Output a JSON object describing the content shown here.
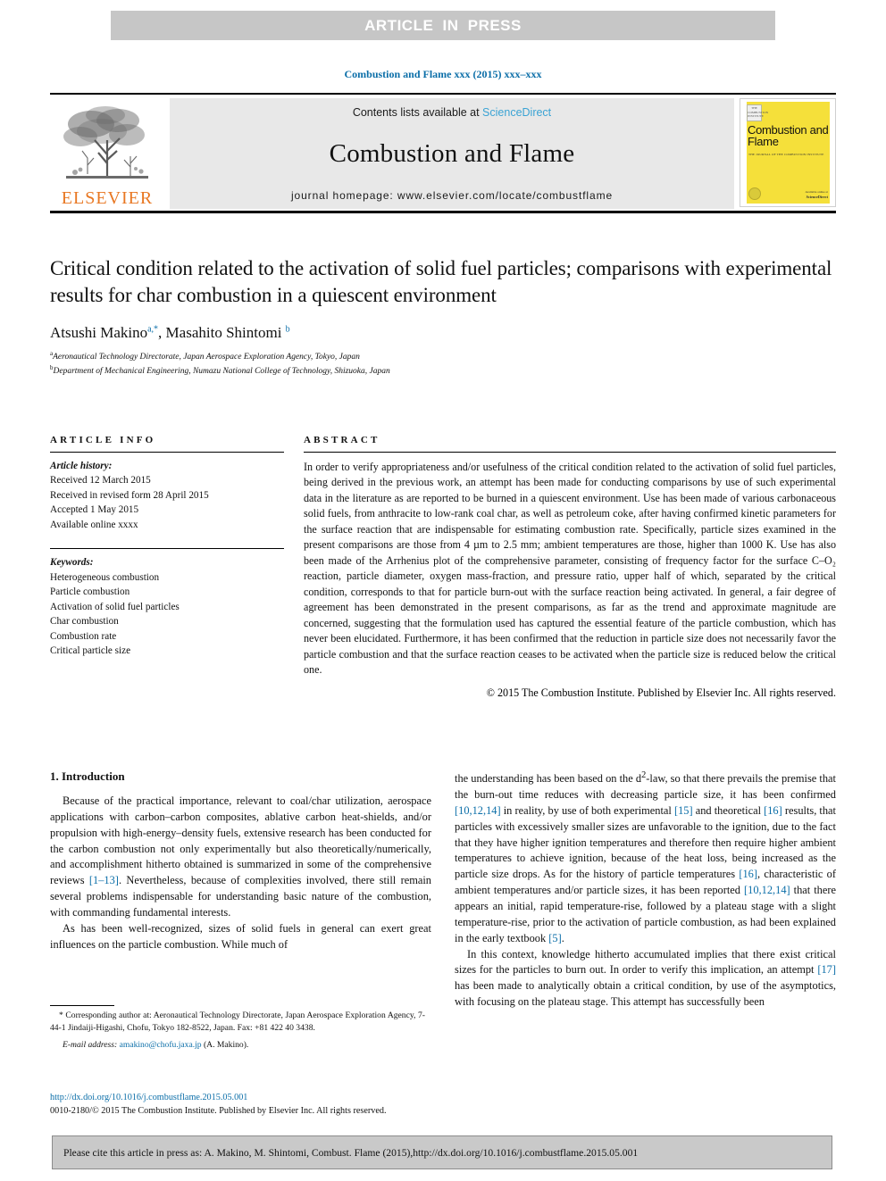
{
  "banner": {
    "text": "ARTICLE  IN  PRESS"
  },
  "journal_ref": "Combustion and Flame xxx (2015) xxx–xxx",
  "masthead": {
    "contents_prefix": "Contents lists available at ",
    "sciencedirect": "ScienceDirect",
    "journal_title": "Combustion and Flame",
    "homepage": "journal homepage: www.elsevier.com/locate/combustflame",
    "publisher_word": "ELSEVIER",
    "cover": {
      "badge": "THE COMBUSTION INSTITUTE",
      "title": "Combustion and Flame",
      "subtitle": "THE JOURNAL OF THE COMBUSTION INSTITUTE",
      "foot_small": "Available online at",
      "foot_bold": "ScienceDirect"
    }
  },
  "article": {
    "title": "Critical condition related to the activation of solid fuel particles; comparisons with experimental results for char combustion in a quiescent environment",
    "authors_1": "Atsushi Makino",
    "authors_sup_1": "a,*",
    "authors_2": ", Masahito Shintomi ",
    "authors_sup_2": "b",
    "affiliation_a_sup": "a",
    "affiliation_a": "Aeronautical Technology Directorate, Japan Aerospace Exploration Agency, Tokyo, Japan",
    "affiliation_b_sup": "b",
    "affiliation_b": "Department of Mechanical Engineering, Numazu National College of Technology, Shizuoka, Japan"
  },
  "info": {
    "heading": "ARTICLE INFO",
    "history_label": "Article history:",
    "history": [
      "Received 12 March 2015",
      "Received in revised form 28 April 2015",
      "Accepted 1 May 2015",
      "Available online xxxx"
    ],
    "keywords_label": "Keywords:",
    "keywords": [
      "Heterogeneous combustion",
      "Particle combustion",
      "Activation of solid fuel particles",
      "Char combustion",
      "Combustion rate",
      "Critical particle size"
    ]
  },
  "abstract": {
    "heading": "ABSTRACT",
    "text": "In order to verify appropriateness and/or usefulness of the critical condition related to the activation of solid fuel particles, being derived in the previous work, an attempt has been made for conducting comparisons by use of such experimental data in the literature as are reported to be burned in a quiescent environment. Use has been made of various carbonaceous solid fuels, from anthracite to low-rank coal char, as well as petroleum coke, after having confirmed kinetic parameters for the surface reaction that are indispensable for estimating combustion rate. Specifically, particle sizes examined in the present comparisons are those from 4 µm to 2.5 mm; ambient temperatures are those, higher than 1000 K. Use has also been made of the Arrhenius plot of the comprehensive parameter, consisting of frequency factor for the surface C–O₂ reaction, particle diameter, oxygen mass-fraction, and pressure ratio, upper half of which, separated by the critical condition, corresponds to that for particle burn-out with the surface reaction being activated. In general, a fair degree of agreement has been demonstrated in the present comparisons, as far as the trend and approximate magnitude are concerned, suggesting that the formulation used has captured the essential feature of the particle combustion, which has never been elucidated. Furthermore, it has been confirmed that the reduction in particle size does not necessarily favor the particle combustion and that the surface reaction ceases to be activated when the particle size is reduced below the critical one.",
    "copyright": "© 2015 The Combustion Institute. Published by Elsevier Inc. All rights reserved."
  },
  "intro": {
    "heading": "1. Introduction",
    "left_p1_a": "Because of the practical importance, relevant to coal/char utilization, aerospace applications with carbon–carbon composites, ablative carbon heat-shields, and/or propulsion with high-energy–density fuels, extensive research has been conducted for the carbon combustion not only experimentally but also theoretically/numerically, and accomplishment hitherto obtained is summarized in some of the comprehensive reviews ",
    "left_p1_ref": "[1–13]",
    "left_p1_b": ". Nevertheless, because of complexities involved, there still remain several problems indispensable for understanding basic nature of the combustion, with commanding fundamental interests.",
    "left_p2": "As has been well-recognized, sizes of solid fuels in general can exert great influences on the particle combustion. While much of",
    "right_p1_a": "the understanding has been based on the d",
    "right_p1_sup": "2",
    "right_p1_b": "-law, so that there prevails the premise that the burn-out time reduces with decreasing particle size, it has been confirmed ",
    "right_ref_1": "[10,12,14]",
    "right_p1_c": " in reality, by use of both experimental ",
    "right_ref_2": "[15]",
    "right_p1_d": " and theoretical ",
    "right_ref_3": "[16]",
    "right_p1_e": " results, that particles with excessively smaller sizes are unfavorable to the ignition, due to the fact that they have higher ignition temperatures and therefore then require higher ambient temperatures to achieve ignition, because of the heat loss, being increased as the particle size drops. As for the history of particle temperatures ",
    "right_ref_4": "[16]",
    "right_p1_f": ", characteristic of ambient temperatures and/or particle sizes, it has been reported ",
    "right_ref_5": "[10,12,14]",
    "right_p1_g": " that there appears an initial, rapid temperature-rise, followed by a plateau stage with a slight temperature-rise, prior to the activation of particle combustion, as had been explained in the early textbook ",
    "right_ref_6": "[5]",
    "right_p1_h": ".",
    "right_p2_a": "In this context, knowledge hitherto accumulated implies that there exist critical sizes for the particles to burn out. In order to verify this implication, an attempt ",
    "right_ref_7": "[17]",
    "right_p2_b": " has been made to analytically obtain a critical condition, by use of the asymptotics, with focusing on the plateau stage. This attempt has successfully been"
  },
  "footnotes": {
    "corresponding": "* Corresponding author at: Aeronautical Technology Directorate, Japan Aerospace Exploration Agency, 7-44-1 Jindaiji-Higashi, Chofu, Tokyo 182-8522, Japan. Fax: +81 422 40 3438.",
    "email_label": "E-mail address:",
    "email": "amakino@chofu.jaxa.jp",
    "email_suffix": " (A. Makino).",
    "doi": "http://dx.doi.org/10.1016/j.combustflame.2015.05.001",
    "issn_line": "0010-2180/© 2015 The Combustion Institute. Published by Elsevier Inc. All rights reserved."
  },
  "cite_box": {
    "prefix": "Please cite this article in press as: A. Makino, M. Shintomi, Combust. Flame (2015), ",
    "link": "http://dx.doi.org/10.1016/j.combustflame.2015.05.001"
  },
  "colors": {
    "link": "#0b6ea8",
    "banner_bg": "#c6c6c6",
    "masthead_bg": "#e8e8e8",
    "elsevier_orange": "#e87722",
    "cover_yellow": "#f5e03a"
  }
}
